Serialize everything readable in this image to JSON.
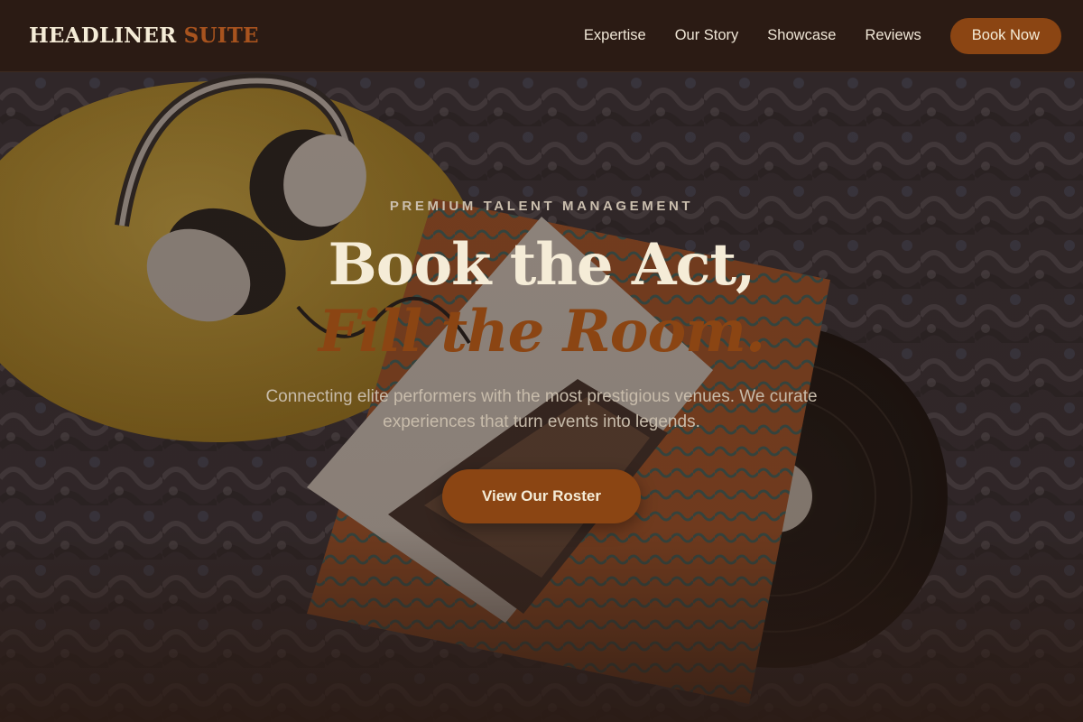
{
  "header": {
    "logo_main": "HEADLINER",
    "logo_accent": "SUITE",
    "nav": [
      {
        "label": "Expertise"
      },
      {
        "label": "Our Story"
      },
      {
        "label": "Showcase"
      },
      {
        "label": "Reviews"
      }
    ],
    "cta_label": "Book Now"
  },
  "hero": {
    "eyebrow": "PREMIUM TALENT MANAGEMENT",
    "headline_line1": "Book the Act,",
    "headline_line2": "Fill the Room.",
    "subtitle": "Connecting elite performers with the most prestigious venues. We curate experiences that turn events into legends.",
    "cta_label": "View Our Roster",
    "background_image": "headphones-and-vinyl-record-on-rug"
  },
  "colors": {
    "background": "#2b1b14",
    "accent": "#8b4513",
    "text_light": "#f5ecd7"
  }
}
